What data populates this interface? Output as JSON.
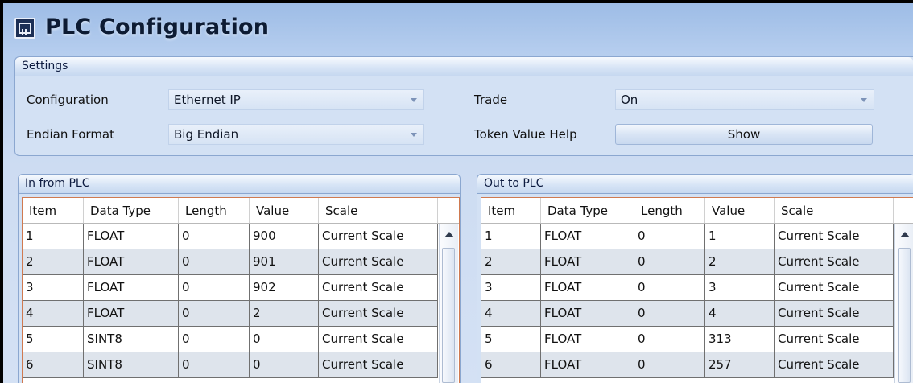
{
  "app": {
    "title": "PLC Configuration"
  },
  "settings": {
    "header": "Settings",
    "configuration_label": "Configuration",
    "configuration_value": "Ethernet IP",
    "endian_label": "Endian Format",
    "endian_value": "Big Endian",
    "trade_label": "Trade",
    "trade_value": "On",
    "token_label": "Token Value Help",
    "show_button": "Show"
  },
  "in_panel": {
    "header": "In from PLC",
    "columns": [
      "Item",
      "Data Type",
      "Length",
      "Value",
      "Scale"
    ],
    "rows": [
      [
        "1",
        "FLOAT",
        "0",
        "900",
        "Current Scale"
      ],
      [
        "2",
        "FLOAT",
        "0",
        "901",
        "Current Scale"
      ],
      [
        "3",
        "FLOAT",
        "0",
        "902",
        "Current Scale"
      ],
      [
        "4",
        "FLOAT",
        "0",
        "2",
        "Current Scale"
      ],
      [
        "5",
        "SINT8",
        "0",
        "0",
        "Current Scale"
      ],
      [
        "6",
        "SINT8",
        "0",
        "0",
        "Current Scale"
      ]
    ]
  },
  "out_panel": {
    "header": "Out to PLC",
    "columns": [
      "Item",
      "Data Type",
      "Length",
      "Value",
      "Scale"
    ],
    "rows": [
      [
        "1",
        "FLOAT",
        "0",
        "1",
        "Current Scale"
      ],
      [
        "2",
        "FLOAT",
        "0",
        "2",
        "Current Scale"
      ],
      [
        "3",
        "FLOAT",
        "0",
        "3",
        "Current Scale"
      ],
      [
        "4",
        "FLOAT",
        "0",
        "4",
        "Current Scale"
      ],
      [
        "5",
        "FLOAT",
        "0",
        "313",
        "Current Scale"
      ],
      [
        "6",
        "FLOAT",
        "0",
        "257",
        "Current Scale"
      ]
    ]
  },
  "icons": {
    "app": "plc-module-icon",
    "dropdown": "chevron-down-icon",
    "scroll_up": "scroll-up-arrow-icon"
  },
  "colors": {
    "background_top": "#9dbce6",
    "background_bottom": "#d4e1f4",
    "group_border": "#8ba7d0",
    "grid_border": "#d07a50",
    "alt_row": "#dee4ec"
  }
}
